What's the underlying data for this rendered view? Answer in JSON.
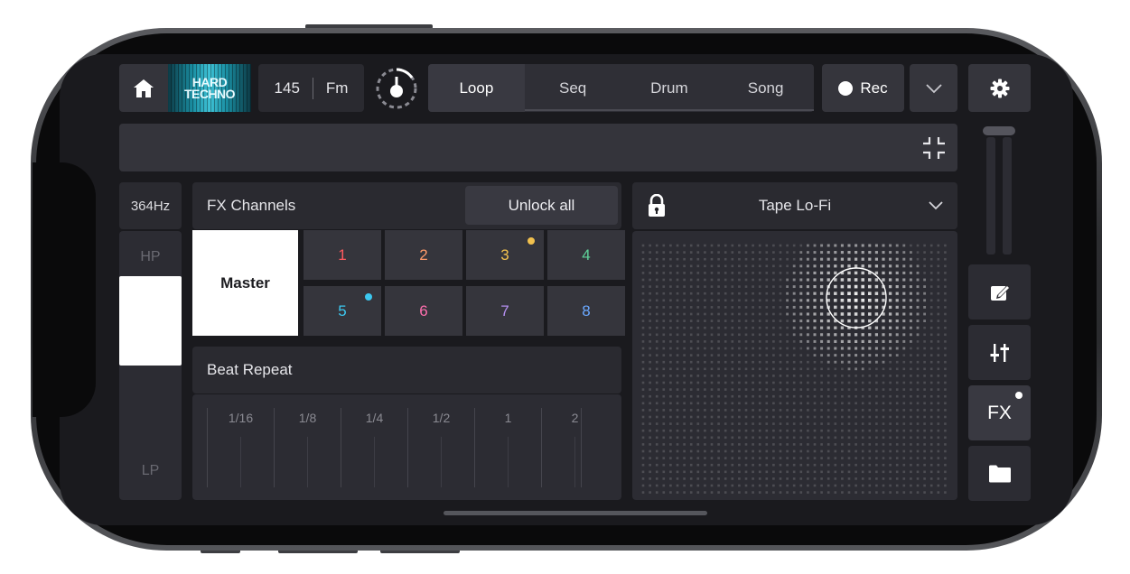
{
  "header": {
    "cover_line1": "HARD",
    "cover_line2": "TECHNO",
    "bpm": "145",
    "key": "Fm",
    "tabs": [
      {
        "label": "Loop",
        "active": true
      },
      {
        "label": "Seq",
        "active": false
      },
      {
        "label": "Drum",
        "active": false
      },
      {
        "label": "Song",
        "active": false
      }
    ],
    "rec_label": "Rec"
  },
  "filter": {
    "frequency": "364Hz",
    "hp_label": "HP",
    "lp_label": "LP"
  },
  "fx_channels": {
    "title": "FX Channels",
    "unlock_label": "Unlock all",
    "master_label": "Master",
    "channels": [
      {
        "label": "1",
        "color": "#ff5a5f",
        "dot": null
      },
      {
        "label": "2",
        "color": "#ff9a6a",
        "dot": null
      },
      {
        "label": "3",
        "color": "#f2c14e",
        "dot": "#f2c14e"
      },
      {
        "label": "4",
        "color": "#5fd39a",
        "dot": null
      },
      {
        "label": "5",
        "color": "#3cc8f0",
        "dot": "#3cc8f0"
      },
      {
        "label": "6",
        "color": "#ff6fae",
        "dot": null
      },
      {
        "label": "7",
        "color": "#b590f0",
        "dot": null
      },
      {
        "label": "8",
        "color": "#6aa8ff",
        "dot": null
      }
    ]
  },
  "beat_repeat": {
    "title": "Beat Repeat",
    "divisions": [
      "1/16",
      "1/8",
      "1/4",
      "1/2",
      "1",
      "2"
    ]
  },
  "xy_pad": {
    "effect_name": "Tape Lo-Fi"
  },
  "side_buttons": {
    "fx_label": "FX"
  },
  "icons": [
    "home-icon",
    "metronome-icon",
    "record-icon",
    "chevron-down-icon",
    "gear-icon",
    "collapse-icon",
    "edit-icon",
    "mixer-icon",
    "fx-icon",
    "folder-icon",
    "lock-icon"
  ]
}
